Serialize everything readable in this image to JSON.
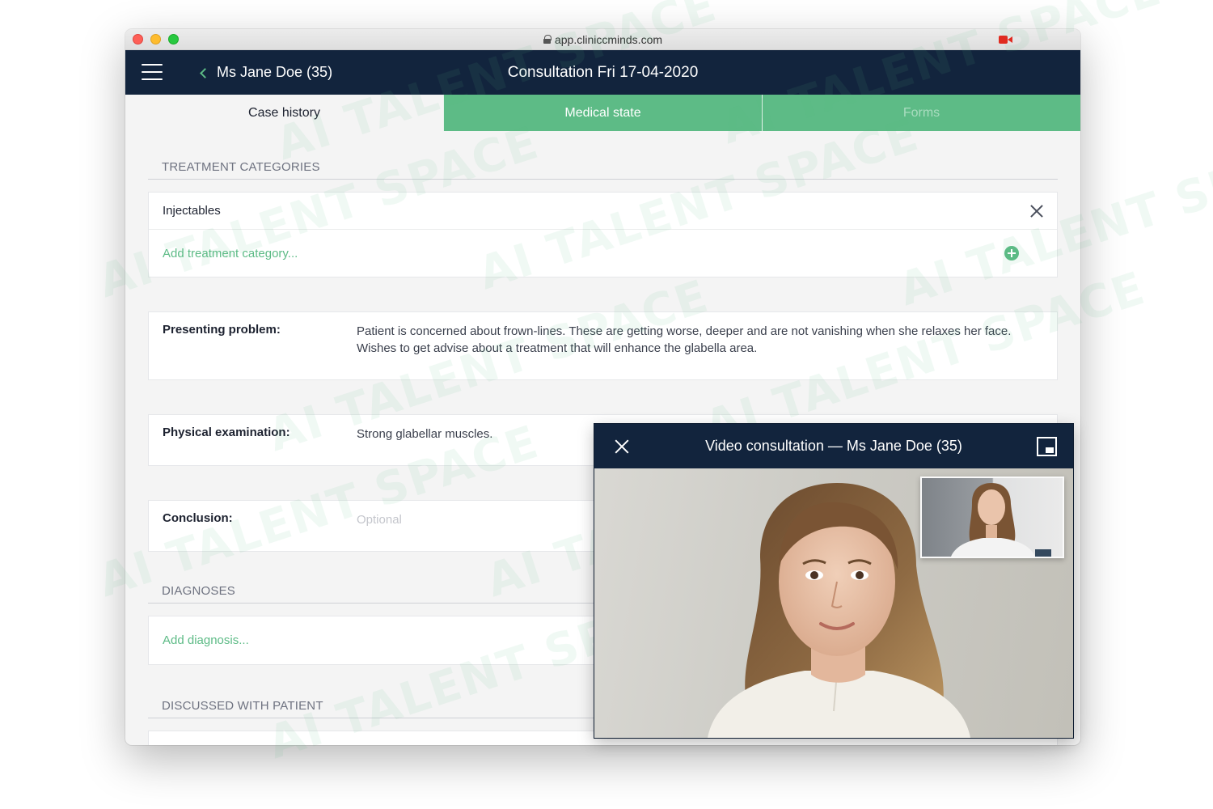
{
  "browser": {
    "url": "app.cliniccminds.com"
  },
  "appbar": {
    "back_label": "Ms Jane Doe (35)",
    "title": "Consultation Fri 17-04-2020"
  },
  "tabs": [
    {
      "label": "Case history",
      "state": "active"
    },
    {
      "label": "Medical state",
      "state": "normal"
    },
    {
      "label": "Forms",
      "state": "disabled"
    }
  ],
  "treatment_categories": {
    "heading": "TREATMENT CATEGORIES",
    "items": [
      {
        "label": "Injectables"
      }
    ],
    "add_label": "Add treatment category..."
  },
  "fields": {
    "presenting_problem": {
      "label": "Presenting problem:",
      "value": "Patient is concerned about frown-lines. These are getting worse, deeper and are not vanishing when she relaxes her face. Wishes to get advise about a treatment that will enhance the glabella area."
    },
    "physical_examination": {
      "label": "Physical examination:",
      "value": "Strong glabellar muscles."
    },
    "conclusion": {
      "label": "Conclusion:",
      "placeholder": "Optional"
    }
  },
  "diagnoses": {
    "heading": "DIAGNOSES",
    "add_label": "Add diagnosis..."
  },
  "discussed": {
    "heading": "DISCUSSED WITH PATIENT"
  },
  "video": {
    "title": "Video consultation — Ms Jane Doe (35)"
  },
  "watermark": {
    "text": "AI TALENT SPACE"
  },
  "colors": {
    "navy": "#12243d",
    "accent_green": "#5dbb86",
    "record_red": "#e02b20"
  }
}
